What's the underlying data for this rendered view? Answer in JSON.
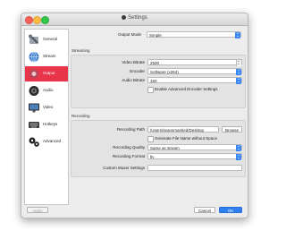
{
  "window": {
    "title": "Settings"
  },
  "sidebar": {
    "items": [
      {
        "label": "General",
        "icon": "wrench-icon",
        "active": false
      },
      {
        "label": "Stream",
        "icon": "globe-icon",
        "active": false
      },
      {
        "label": "Output",
        "icon": "output-icon",
        "active": true
      },
      {
        "label": "Audio",
        "icon": "speaker-icon",
        "active": false
      },
      {
        "label": "Video",
        "icon": "monitor-icon",
        "active": false
      },
      {
        "label": "Hotkeys",
        "icon": "keyboard-icon",
        "active": false
      },
      {
        "label": "Advanced",
        "icon": "gears-icon",
        "active": false
      }
    ]
  },
  "output": {
    "mode_label": "Output Mode",
    "mode_value": "Simple"
  },
  "streaming": {
    "title": "Streaming",
    "video_bitrate_label": "Video Bitrate",
    "video_bitrate_value": "2500",
    "encoder_label": "Encoder",
    "encoder_value": "Software (x264)",
    "audio_bitrate_label": "Audio Bitrate",
    "audio_bitrate_value": "160",
    "advanced_label": "Enable Advanced Encoder Settings"
  },
  "recording": {
    "title": "Recording",
    "path_label": "Recording Path",
    "path_value": "/Users/seansmashed/Desktop",
    "browse_label": "Browse",
    "no_space_label": "Generate File Name without Space",
    "quality_label": "Recording Quality",
    "quality_value": "Same as stream",
    "format_label": "Recording Format",
    "format_value": "flv",
    "muxer_label": "Custom Muxer Settings",
    "muxer_value": ""
  },
  "footer": {
    "apply": "Apply",
    "cancel": "Cancel",
    "ok": "OK"
  },
  "colors": {
    "accent": "#e8354a",
    "select_arrow": "#3b88f5",
    "ok_button": "#2f7ff0"
  }
}
